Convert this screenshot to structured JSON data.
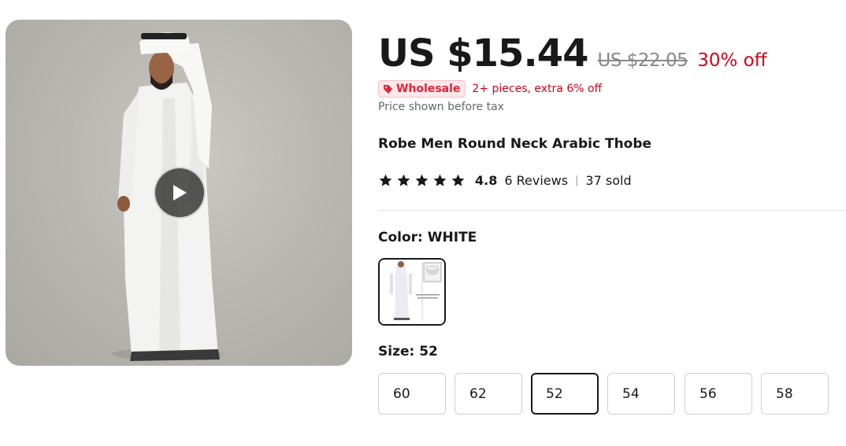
{
  "price": {
    "current": "US $15.44",
    "original": "US $22.05",
    "discount": "30% off"
  },
  "wholesale": {
    "badge_label": "Wholesale",
    "text": "2+ pieces, extra 6% off"
  },
  "tax_note": "Price shown before tax",
  "product": {
    "title": "Robe Men Round Neck Arabic Thobe"
  },
  "rating": {
    "stars": 5,
    "value": "4.8",
    "reviews": "6 Reviews",
    "separator": "|",
    "sold": "37 sold"
  },
  "color": {
    "label_prefix": "Color: ",
    "selected": "WHITE"
  },
  "size": {
    "label_prefix": "Size: ",
    "selected": "52",
    "options": [
      "60",
      "62",
      "52",
      "54",
      "56",
      "58"
    ]
  },
  "colors": {
    "accent_red": "#d3031c",
    "text": "#191919",
    "muted": "#666666"
  },
  "media": {
    "play_icon": "play-icon"
  }
}
